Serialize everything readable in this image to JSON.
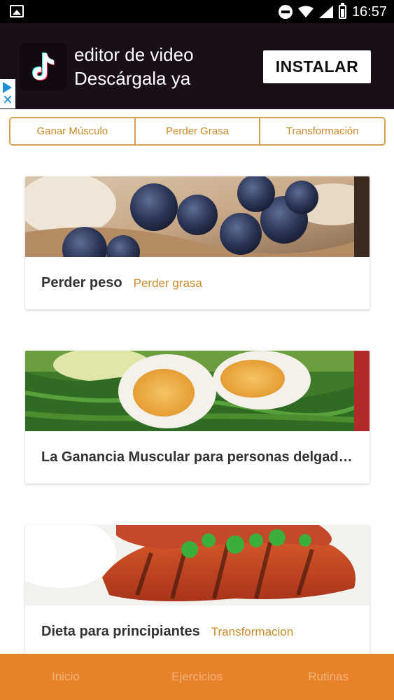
{
  "status_bar": {
    "time": "16:57",
    "icons": [
      "picture-icon",
      "do-not-disturb-icon",
      "wifi-icon",
      "signal-icon",
      "battery-icon"
    ]
  },
  "ad": {
    "title": "editor de video",
    "subtitle": "Descárgala ya",
    "install_label": "INSTALAR",
    "logo_icon": "tiktok-logo-icon",
    "adchoices_icon": "adchoices-icon",
    "colors": {
      "background": "#1a0e18",
      "button": "#ffffff"
    }
  },
  "tabs": [
    {
      "label": "Ganar Músculo"
    },
    {
      "label": "Perder Grasa"
    },
    {
      "label": "Transformación"
    }
  ],
  "cards": [
    {
      "title": "Perder peso",
      "tag": "Perder grasa",
      "image": "blueberries-oatmeal"
    },
    {
      "title": "La Ganancia Muscular para personas delgadas",
      "tag": "",
      "image": "eggs-spinach"
    },
    {
      "title": "Dieta para principiantes",
      "tag": "Transformacion",
      "image": "grilled-chicken"
    }
  ],
  "bottom_nav": [
    {
      "label": "Inicio"
    },
    {
      "label": "Ejercicios"
    },
    {
      "label": "Rutinas"
    }
  ],
  "colors": {
    "accent": "#c98a2c",
    "tab_border": "#d9a04e",
    "bottom_nav": "#e8822a",
    "bottom_nav_text": "#f2b47b"
  }
}
